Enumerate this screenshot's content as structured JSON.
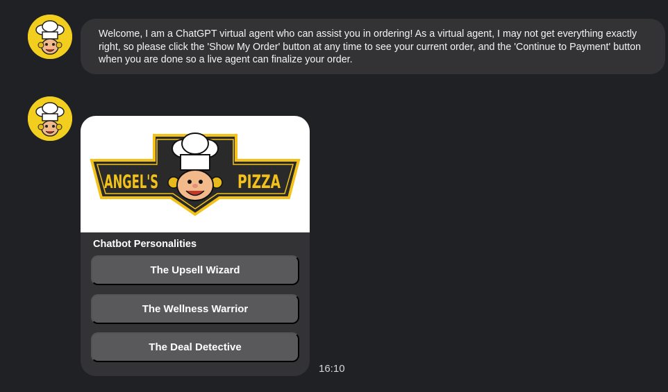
{
  "messages": [
    {
      "sender_avatar": "chef-mascot-avatar",
      "text": "Welcome, I am a ChatGPT virtual agent who can assist you in ordering! As a virtual agent, I may not get everything exactly right, so please click the 'Show My Order' button at any time to see your current order, and the 'Continue to Payment' button when you are done so a live agent can finalize your order."
    },
    {
      "sender_avatar": "chef-mascot-avatar",
      "card": {
        "logo": {
          "left_text": "ANGEL'S",
          "right_text": "PIZZA"
        },
        "title": "Chatbot Personalities",
        "options": [
          "The Upsell Wizard",
          "The Wellness Warrior",
          "The Deal Detective"
        ]
      },
      "timestamp": "16:10"
    }
  ],
  "colors": {
    "background": "#202124",
    "bubble": "#333335",
    "button": "#59595b",
    "avatar": "#f2cf1e",
    "logo_gold": "#f2c21b",
    "logo_dark": "#2a2a2a"
  }
}
